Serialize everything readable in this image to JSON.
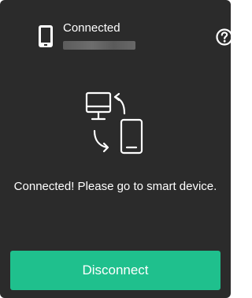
{
  "header": {
    "status_label": "Connected",
    "device_icon": "smartphone-icon",
    "help_icon": "question-circle-icon"
  },
  "illustration": {
    "icon": "computer-phone-sync-icon"
  },
  "message": "Connected! Please go to smart device.",
  "actions": {
    "disconnect_label": "Disconnect"
  },
  "colors": {
    "panel_background": "#2b2b2b",
    "accent": "#1fc08d",
    "text": "#ffffff"
  }
}
